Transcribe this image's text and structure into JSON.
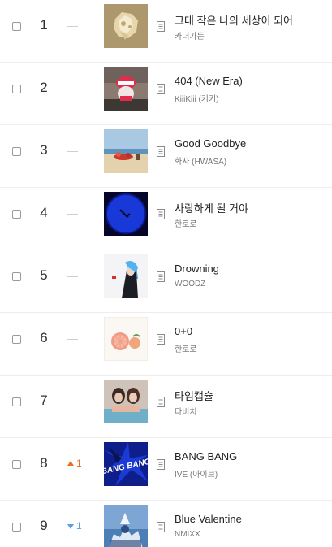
{
  "colors": {
    "rank_up": "#e8701a",
    "rank_down": "#5c9de0",
    "divider": "#ededed"
  },
  "chart_rows": [
    {
      "rank": "1",
      "change": {
        "direction": "same"
      },
      "title": "그대 작은 나의 세상이 되어",
      "artist": "카더가든",
      "cover": "cover-1"
    },
    {
      "rank": "2",
      "change": {
        "direction": "same"
      },
      "title": "404 (New Era)",
      "artist": "KiiiKiii (키키)",
      "cover": "cover-2"
    },
    {
      "rank": "3",
      "change": {
        "direction": "same"
      },
      "title": "Good Goodbye",
      "artist": "화사 (HWASA)",
      "cover": "cover-3"
    },
    {
      "rank": "4",
      "change": {
        "direction": "same"
      },
      "title": "사랑하게 될 거야",
      "artist": "한로로",
      "cover": "cover-4"
    },
    {
      "rank": "5",
      "change": {
        "direction": "same"
      },
      "title": "Drowning",
      "artist": "WOODZ",
      "cover": "cover-5"
    },
    {
      "rank": "6",
      "change": {
        "direction": "same"
      },
      "title": "0+0",
      "artist": "한로로",
      "cover": "cover-6"
    },
    {
      "rank": "7",
      "change": {
        "direction": "same"
      },
      "title": "타임캡슐",
      "artist": "다비치",
      "cover": "cover-7"
    },
    {
      "rank": "8",
      "change": {
        "direction": "up",
        "amount": "1"
      },
      "title": "BANG BANG",
      "artist": "IVE (아이브)",
      "cover": "cover-8",
      "cover_text": "BANG BANG"
    },
    {
      "rank": "9",
      "change": {
        "direction": "down",
        "amount": "1"
      },
      "title": "Blue Valentine",
      "artist": "NMIXX",
      "cover": "cover-9"
    }
  ],
  "icons": {
    "checkbox": "checkbox",
    "info": "song-info-icon",
    "no_change": "no-change-dash-icon",
    "rank_up": "rank-up-arrow-icon",
    "rank_down": "rank-down-arrow-icon"
  }
}
